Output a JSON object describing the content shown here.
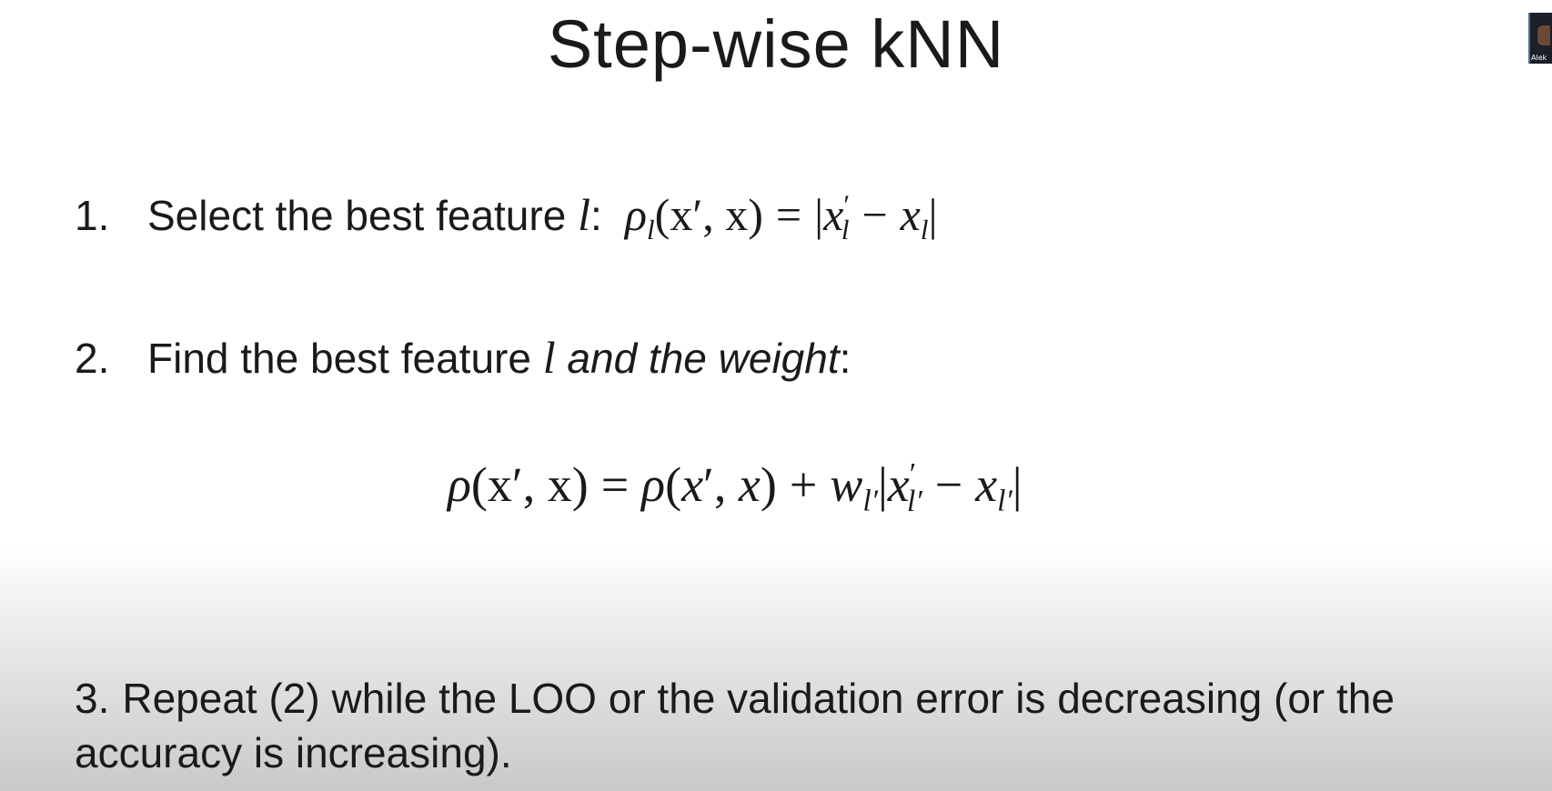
{
  "slide": {
    "title": "Step-wise kNN",
    "item1": {
      "number": "1.",
      "text": "Select the best feature ",
      "var": "l",
      "colon": ":"
    },
    "item2": {
      "number": "2.",
      "text": "Find the best feature ",
      "var": "l",
      "italic_text": " and the weight",
      "colon": ":"
    },
    "item3": {
      "number": "3.",
      "text": "Repeat (2) while the LOO or the validation error is decreasing (or the accuracy is increasing)."
    }
  },
  "video_thumbnail": {
    "label": "Alek"
  }
}
